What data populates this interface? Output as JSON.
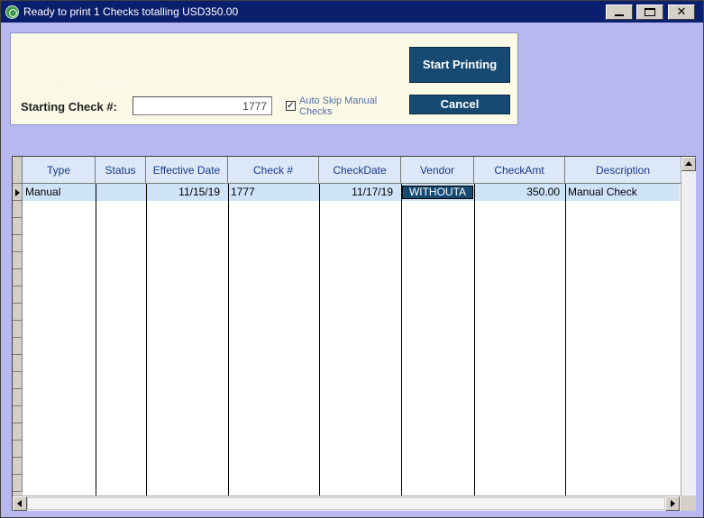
{
  "window": {
    "title": "Ready to print 1 Checks totalling USD350.00",
    "controls": {
      "minimize_icon": "minimize-icon",
      "maximize_icon": "maximize-icon",
      "close_label": "✕"
    }
  },
  "panel": {
    "faint_hint": "Check 1 checks in this session",
    "starting_check_label": "Starting Check #:",
    "starting_check_value": "1777",
    "auto_skip_label": "Auto Skip Manual Checks",
    "auto_skip_checked": "✓",
    "start_printing_label": "Start Printing",
    "cancel_label": "Cancel"
  },
  "grid": {
    "columns": [
      "Type",
      "Status",
      "Effective Date",
      "Check #",
      "CheckDate",
      "Vendor",
      "CheckAmt",
      "Description"
    ],
    "rows": [
      {
        "type": "Manual",
        "status": "",
        "effective_date": "11/15/19",
        "check_no": "1777",
        "check_date": "11/17/19",
        "vendor": "WITHOUTA",
        "check_amt": "350.00",
        "description": "Manual Check"
      }
    ]
  },
  "colors": {
    "title_bar": "#0a1f6e",
    "window_bg": "#b8b8f0",
    "panel_bg": "#fafae6",
    "button_bg": "#164a72",
    "selected_row": "#cfe3f8"
  }
}
